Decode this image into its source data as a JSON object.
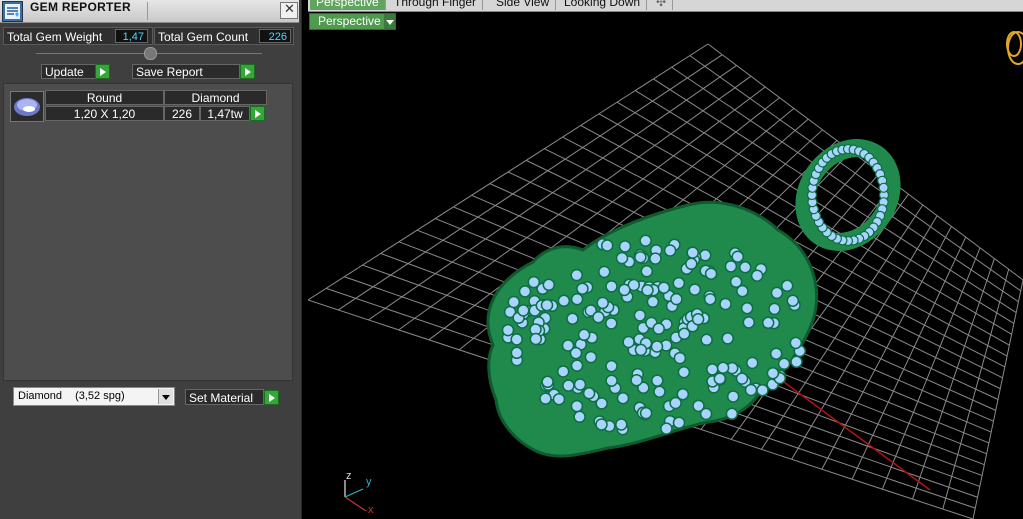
{
  "panel": {
    "title": "GEM REPORTER",
    "close_glyph": "✕",
    "total_weight_label": "Total Gem Weight",
    "total_weight_value": "1,47",
    "total_count_label": "Total Gem Count",
    "total_count_value": "226",
    "update_label": "Update",
    "save_report_label": "Save Report",
    "gem_row": {
      "header_shape": "Round",
      "header_material": "Diamond",
      "size": "1,20 X 1,20",
      "count": "226",
      "weight": "1,47tw"
    },
    "material_select": {
      "name": "Diamond",
      "density": "(3,52 spg)"
    },
    "set_material_label": "Set Material"
  },
  "viewport": {
    "tabs": [
      "Perspective",
      "Through Finger",
      "Side View",
      "Looking Down"
    ],
    "add_tab_glyph": "✣",
    "view_dropdown": "Perspective",
    "axes": {
      "z": "z",
      "y": "y",
      "x": "x"
    }
  },
  "colors": {
    "accent_green": "#35a63a",
    "value_cyan": "#4fd6ff",
    "metal_green": "#1f8a4c",
    "gem_blue": "#a8d4ff",
    "grid": "#8a8a8a"
  },
  "icons": {
    "title": "gem-reporter-icon",
    "gem_thumb": "round-gem-icon"
  }
}
